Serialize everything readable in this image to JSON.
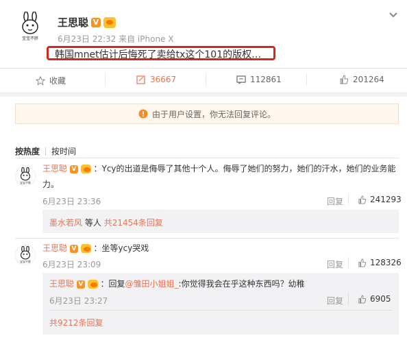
{
  "post": {
    "author": "王思聪",
    "avatar_caption": "宝宝不胖",
    "timestamp": "6月23日 22:32 来自 iPhone X",
    "text": "韩国mnet估计后悔死了卖给tx这个101的版权…"
  },
  "actions": {
    "favorite": "收藏",
    "repost_count": "36667",
    "comment_count": "112861",
    "like_count": "201264"
  },
  "notice": "由于用户设置，你无法回复评论。",
  "sort": {
    "hot": "按热度",
    "time": "按时间"
  },
  "comments": [
    {
      "author": "王思聪",
      "avatar_caption": "宝宝不胖",
      "text_line1": "：Ycy的出道是侮辱了其他十个人。侮辱了她们的努力，她们的汗水，她们的业务能",
      "text_line2": "力。",
      "time": "6月23日 23:36",
      "reply": "回复",
      "likes": "241293",
      "sub_author": "墨水若风",
      "sub_text": "等人",
      "sub_link": "共21454条回复"
    },
    {
      "author": "王思聪",
      "avatar_caption": "宝宝不胖",
      "text": "：坐等ycy哭戏",
      "time": "6月23日 23:09",
      "reply": "回复",
      "likes": "128326",
      "reply_block": {
        "author": "王思聪",
        "prefix": "：回复",
        "mention": "@雏田小姐姐_",
        "text": ":你觉得我会在乎这种东西吗？幼稚",
        "time": "6月23日 23:27",
        "reply": "回复",
        "likes": "6905"
      },
      "more_link": "共9212条回复"
    }
  ],
  "colors": {
    "accent": "#eb7350",
    "highlight_border": "#d9261c",
    "notice_bg": "#fff7ed",
    "notice_icon": "#f28c28",
    "vbadge": "#f7931e"
  }
}
